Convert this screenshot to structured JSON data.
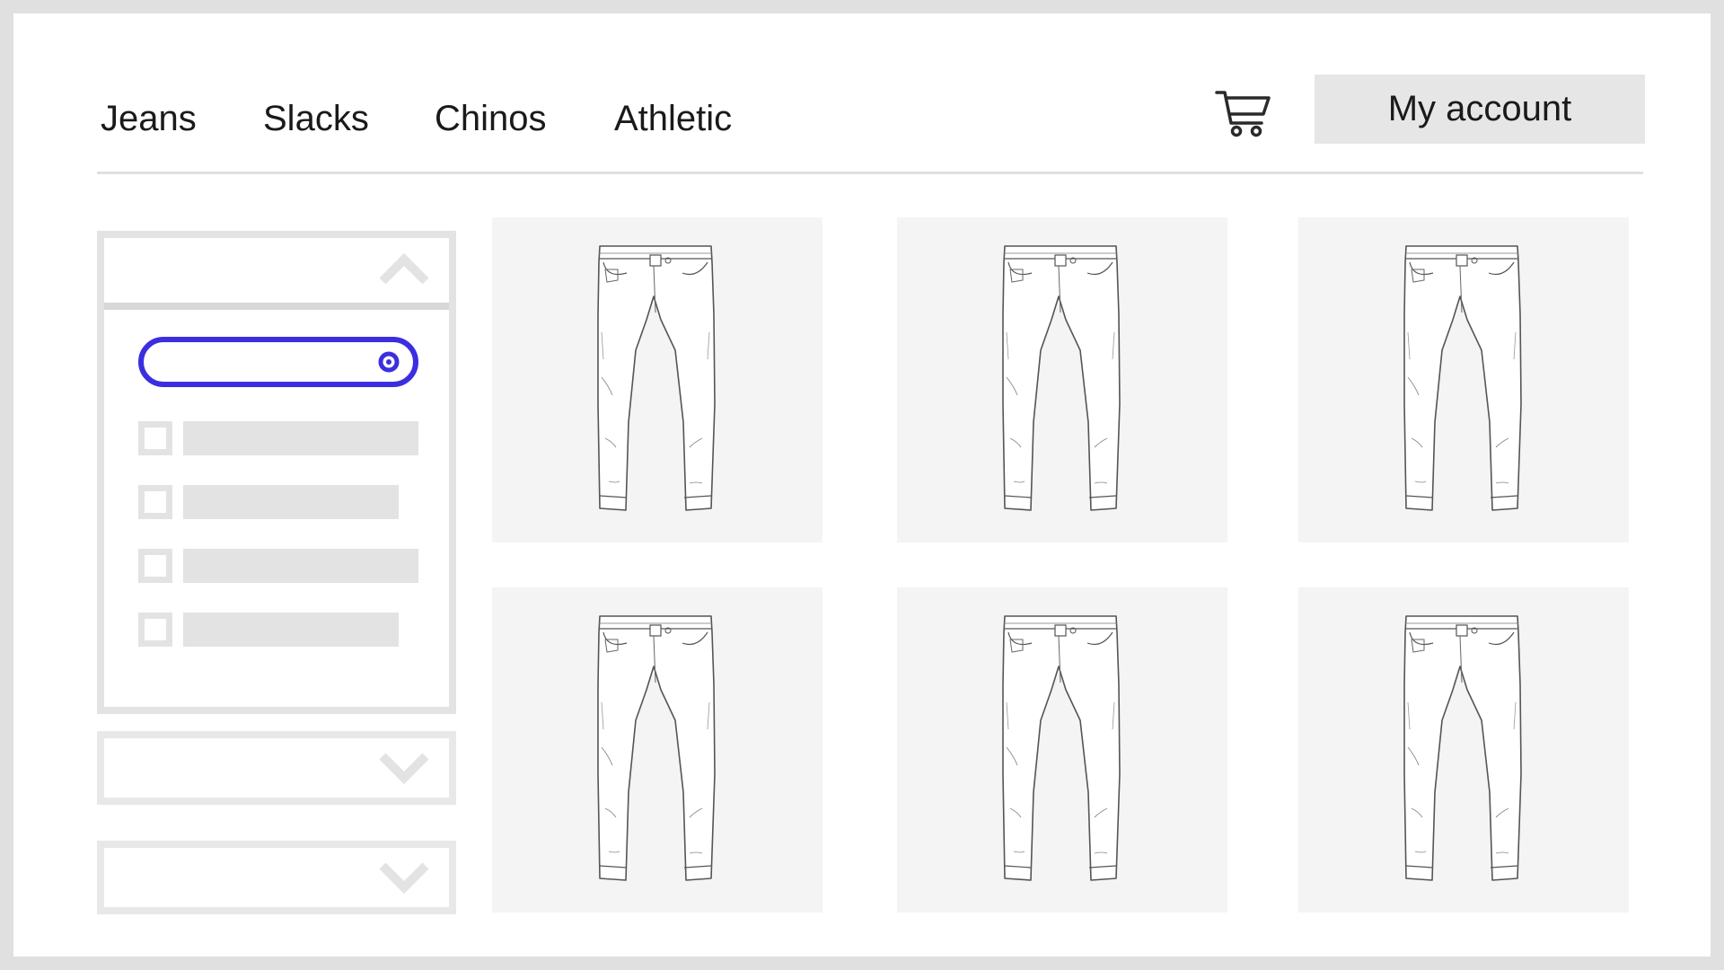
{
  "nav": {
    "items": [
      {
        "label": "Jeans"
      },
      {
        "label": "Slacks"
      },
      {
        "label": "Chinos"
      },
      {
        "label": "Athletic"
      }
    ]
  },
  "header": {
    "cart_icon": "shopping-cart-icon",
    "account_label": "My account"
  },
  "filters": {
    "panels": [
      {
        "state": "expanded",
        "icon": "chevron-up-icon"
      },
      {
        "state": "collapsed",
        "icon": "chevron-down-icon"
      },
      {
        "state": "collapsed",
        "icon": "chevron-down-icon"
      }
    ],
    "search": {
      "value": "",
      "accent": "#3b2ee0"
    },
    "options": [
      {
        "checked": false
      },
      {
        "checked": false
      },
      {
        "checked": false
      },
      {
        "checked": false
      }
    ]
  },
  "products": {
    "icon": "jeans-icon",
    "count_visible": 6
  },
  "colors": {
    "accent": "#3b2ee0",
    "placeholder": "#e3e3e3",
    "tile_bg": "#f4f4f4"
  }
}
